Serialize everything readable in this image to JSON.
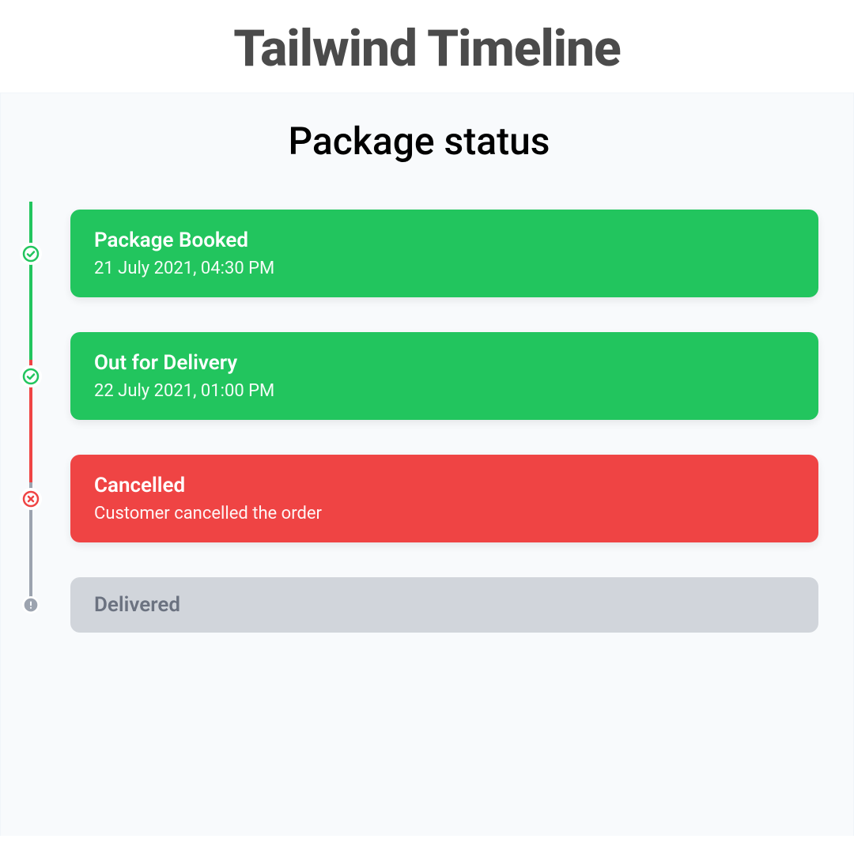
{
  "header": {
    "title": "Tailwind Timeline"
  },
  "panel": {
    "title": "Package status"
  },
  "timeline": {
    "items": [
      {
        "title": "Package Booked",
        "sub": "21 July 2021, 04:30 PM",
        "status": "success",
        "icon": "check-circle",
        "color": "green"
      },
      {
        "title": "Out for Delivery",
        "sub": "22 July 2021, 01:00 PM",
        "status": "success",
        "icon": "check-circle",
        "color": "green"
      },
      {
        "title": "Cancelled",
        "sub": "Customer cancelled the order",
        "status": "cancelled",
        "icon": "x-circle",
        "color": "red"
      },
      {
        "title": "Delivered",
        "sub": "",
        "status": "pending",
        "icon": "alert-circle",
        "color": "gray"
      }
    ]
  },
  "colors": {
    "green": "#22c55e",
    "red": "#ef4444",
    "gray": "#9ca3af",
    "grayCard": "#d1d5db",
    "grayText": "#6b7280",
    "panelBg": "#f8fafc"
  }
}
